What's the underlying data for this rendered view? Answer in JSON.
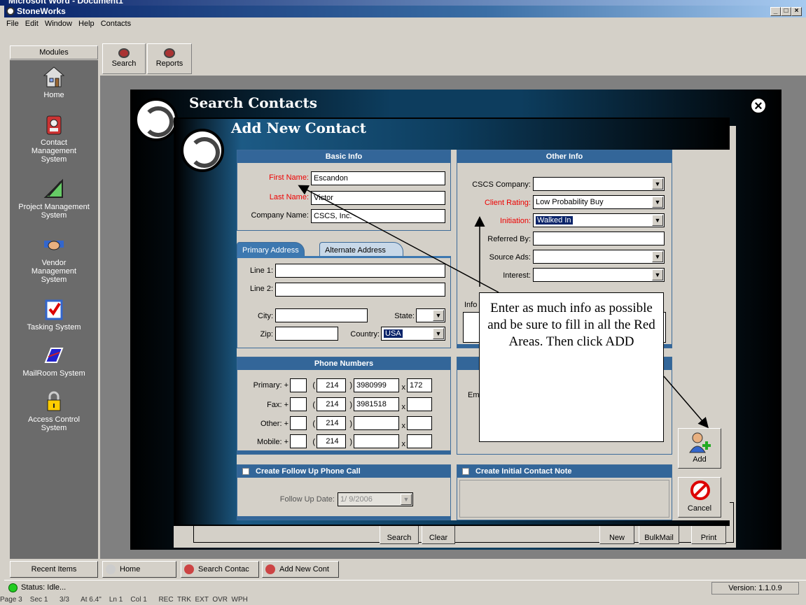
{
  "word_title": "Microsoft Word - Document1",
  "app_title": "StoneWorks",
  "menu": [
    "File",
    "Edit",
    "Window",
    "Help",
    "Contacts"
  ],
  "modules_label": "Modules",
  "toolbar": {
    "search": "Search",
    "reports": "Reports"
  },
  "sidebar": [
    {
      "label": "Home",
      "icon": "house-icon"
    },
    {
      "label": "Contact Management System",
      "icon": "contacts-icon"
    },
    {
      "label": "Project Management System",
      "icon": "drafting-icon"
    },
    {
      "label": "Vendor Management System",
      "icon": "handshake-icon"
    },
    {
      "label": "Tasking System",
      "icon": "checklist-icon"
    },
    {
      "label": "MailRoom System",
      "icon": "mail-icon"
    },
    {
      "label": "Access Control System",
      "icon": "lock-icon"
    }
  ],
  "search_contacts": {
    "title": "Search Contacts",
    "buttons": {
      "search": "Search",
      "clear": "Clear",
      "new": "New",
      "bulkmail": "BulkMail",
      "print": "Print"
    }
  },
  "add_contact": {
    "title": "Add New Contact",
    "basic": {
      "header": "Basic Info",
      "first_name_label": "First Name:",
      "first_name": "Escandon",
      "last_name_label": "Last Name:",
      "last_name": "Victor",
      "company_label": "Company Name:",
      "company": "CSCS, Inc."
    },
    "address": {
      "tab_primary": "Primary Address",
      "tab_alternate": "Alternate Address",
      "line1_label": "Line 1:",
      "line2_label": "Line 2:",
      "city_label": "City:",
      "state_label": "State:",
      "zip_label": "Zip:",
      "country_label": "Country:",
      "country": "USA"
    },
    "phone": {
      "header": "Phone Numbers",
      "primary_label": "Primary: +",
      "primary_area": "214",
      "primary_number": "3980999",
      "primary_ext": "172",
      "fax_label": "Fax: +",
      "fax_area": "214",
      "fax_number": "3981518",
      "other_label": "Other: +",
      "other_area": "214",
      "mobile_label": "Mobile: +",
      "mobile_area": "214"
    },
    "other": {
      "header": "Other Info",
      "cscs_label": "CSCS Company:",
      "rating_label": "Client Rating:",
      "rating": "Low Probability Buy",
      "initiation_label": "Initiation:",
      "initiation": "Walked In",
      "referred_label": "Referred By:",
      "source_label": "Source Ads:",
      "interest_label": "Interest:",
      "info_label": "Info",
      "email_label": "Em"
    },
    "followup": {
      "header": "Create Follow Up Phone Call",
      "date_label": "Follow Up Date:",
      "date": "1/ 9/2006"
    },
    "note": {
      "header": "Create Initial Contact Note"
    },
    "add_button": "Add",
    "cancel_button": "Cancel"
  },
  "callout": "Enter as much info as possible and be sure to fill in all the Red Areas. Then click ADD",
  "bottom": {
    "recent": "Recent Items",
    "home": "Home",
    "search": "Search Contac",
    "add": "Add New Cont",
    "status": "Status: Idle...",
    "version": "Version: 1.1.0.9"
  },
  "word_status": "Page 3    Sec 1      3/3      At 6.4\"    Ln 1    Col 1      REC  TRK  EXT  OVR  WPH"
}
